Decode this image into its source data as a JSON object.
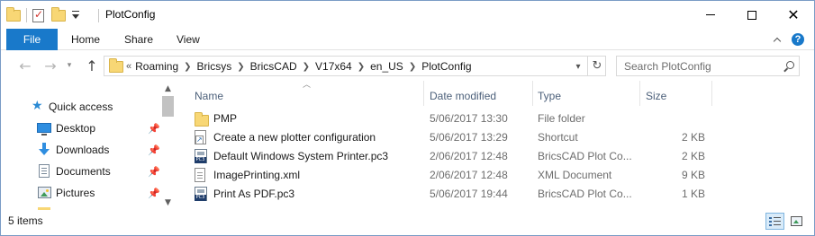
{
  "window": {
    "title": "PlotConfig",
    "minimize_icon": "minimize-icon",
    "maximize_icon": "maximize-icon",
    "close_icon": "close-icon"
  },
  "ribbon": {
    "file_tab": "File",
    "tabs": [
      "Home",
      "Share",
      "View"
    ],
    "accent_color": "#1979ca",
    "help_label": "?"
  },
  "navigation": {
    "back_icon": "arrow-left-icon",
    "forward_icon": "arrow-right-icon",
    "up_icon": "arrow-up-icon",
    "breadcrumb_overflow": "«",
    "breadcrumbs": [
      "Roaming",
      "Bricsys",
      "BricsCAD",
      "V17x64",
      "en_US",
      "PlotConfig"
    ]
  },
  "search": {
    "placeholder": "Search PlotConfig"
  },
  "sidebar": {
    "items": [
      {
        "label": "Quick access",
        "icon": "star-icon",
        "pinned": false
      },
      {
        "label": "Desktop",
        "icon": "desktop-icon",
        "pinned": true
      },
      {
        "label": "Downloads",
        "icon": "download-icon",
        "pinned": true
      },
      {
        "label": "Documents",
        "icon": "document-icon",
        "pinned": true
      },
      {
        "label": "Pictures",
        "icon": "pictures-icon",
        "pinned": true
      }
    ]
  },
  "filelist": {
    "columns": [
      "Name",
      "Date modified",
      "Type",
      "Size"
    ],
    "sort_column": "Name",
    "rows": [
      {
        "name": "PMP",
        "date": "5/06/2017 13:30",
        "type": "File folder",
        "size": "",
        "icon": "folder-icon"
      },
      {
        "name": "Create a new plotter configuration",
        "date": "5/06/2017 13:29",
        "type": "Shortcut",
        "size": "2 KB",
        "icon": "shortcut-icon"
      },
      {
        "name": "Default Windows System Printer.pc3",
        "date": "2/06/2017 12:48",
        "type": "BricsCAD Plot Co...",
        "size": "2 KB",
        "icon": "pc3-file-icon"
      },
      {
        "name": "ImagePrinting.xml",
        "date": "2/06/2017 12:48",
        "type": "XML Document",
        "size": "9 KB",
        "icon": "xml-file-icon"
      },
      {
        "name": "Print As PDF.pc3",
        "date": "5/06/2017 19:44",
        "type": "BricsCAD Plot Co...",
        "size": "1 KB",
        "icon": "pc3-file-icon"
      }
    ]
  },
  "status": {
    "item_count": "5 items",
    "active_view": "details"
  }
}
